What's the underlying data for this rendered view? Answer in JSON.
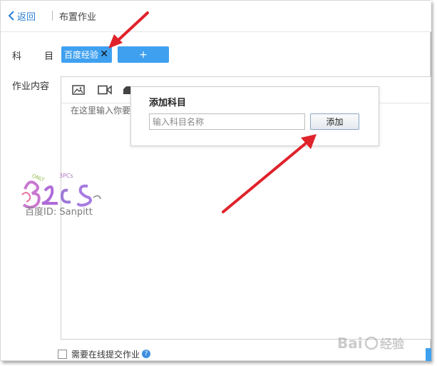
{
  "header": {
    "back_label": "返回",
    "title": "布置作业"
  },
  "form": {
    "subject_label": "科 目",
    "subject_tag": "百度经验",
    "add_subject_symbol": "+",
    "content_label": "作业内容",
    "editor_placeholder": "在这里输入你要"
  },
  "toolbar": {
    "icons": [
      "image-icon",
      "video-icon",
      "more-icon"
    ]
  },
  "popup": {
    "title": "添加科目",
    "input_placeholder": "输入科目名称",
    "add_button": "添加"
  },
  "footer": {
    "submit_online_label": "需要在线提交作业",
    "help_symbol": "?"
  },
  "watermark": {
    "text": "百度ID: Sanpitt"
  },
  "colors": {
    "accent": "#3fa0f0",
    "link": "#2a7fd4",
    "annotation_arrow": "#e0222a"
  }
}
